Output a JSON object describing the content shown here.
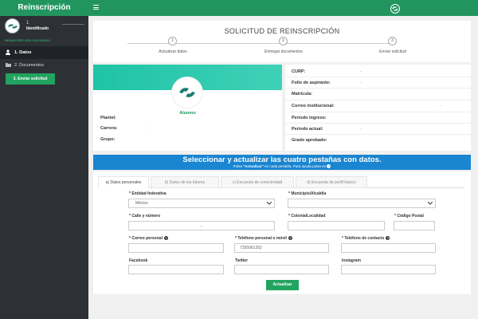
{
  "sidebar": {
    "brand": "Reinscripción",
    "user_dot": "1",
    "user_status": "Identificado",
    "section_label": "REINSCRIPCIÓN 2022/2023/1",
    "items": [
      {
        "label": "1. Datos",
        "icon": "person-icon"
      },
      {
        "label": "2. Documentos",
        "icon": "folder-icon"
      }
    ],
    "send_button": "3. Enviar solicitud"
  },
  "header": {
    "title": "SOLICITUD DE REINSCRIPCIÓN",
    "steps": [
      {
        "num": "1",
        "label": "Actualizar datos"
      },
      {
        "num": "2",
        "label": "Entregar documentos"
      },
      {
        "num": "3",
        "label": "Enviar solicitud"
      }
    ]
  },
  "profile": {
    "role": "Alumno",
    "fields": [
      {
        "label": "Plantel:",
        "value": "-"
      },
      {
        "label": "Carrera:",
        "value": "-"
      },
      {
        "label": "Grupo:",
        "value": ""
      }
    ]
  },
  "info": {
    "fields": [
      {
        "label": "CURP:",
        "value": "-"
      },
      {
        "label": "Folio de aspirante:",
        "value": "-"
      },
      {
        "label": "Matrícula:",
        "value": ""
      },
      {
        "label": "Correo institucional:",
        "value": "-"
      },
      {
        "label": "Periodo ingreso:",
        "value": ""
      },
      {
        "label": "Periodo actual:",
        "value": "-"
      },
      {
        "label": "Grado aprobado:",
        "value": ""
      }
    ]
  },
  "banner": {
    "title": "Seleccionar y actualizar las cuatro pestañas con datos.",
    "sub_prefix": "Pulsa ",
    "sub_bold": "\"Actualizar\"",
    "sub_suffix": " en cada pestaña. Para ayuda pulsa en",
    "help_glyph": "?"
  },
  "form": {
    "tabs": [
      "a) Datos personales",
      "b) Datos de los tutores",
      "c) Encuesta de conectividad",
      "d) Encuesta de perfil básico"
    ],
    "labels": {
      "entidad": "* Entidad federativa",
      "municipio": "* Municipio/Alcaldía",
      "calle": "* Calle y número",
      "colonia": "* Colonia/Localidad",
      "cp": "* Código Postal",
      "correo": "* Correo personal",
      "telefono": "* Teléfono personal o móvil",
      "contacto": "* Teléfono de contacto",
      "facebook": "Facebook",
      "twitter": "Twitter",
      "instagram": "Instagram"
    },
    "values": {
      "entidad": "México",
      "municipio": "",
      "calle": "...",
      "colonia": "",
      "cp": "",
      "correo": "",
      "telefono": "7295061262",
      "contacto": "",
      "facebook": "",
      "twitter": "",
      "instagram": ""
    },
    "help_glyph": "?",
    "update_button": "Actualizar"
  },
  "colors": {
    "primary": "#22955f",
    "sidebar": "#2d3035",
    "banner": "#1a85d0",
    "profile_banner": "#1fc3a6"
  }
}
